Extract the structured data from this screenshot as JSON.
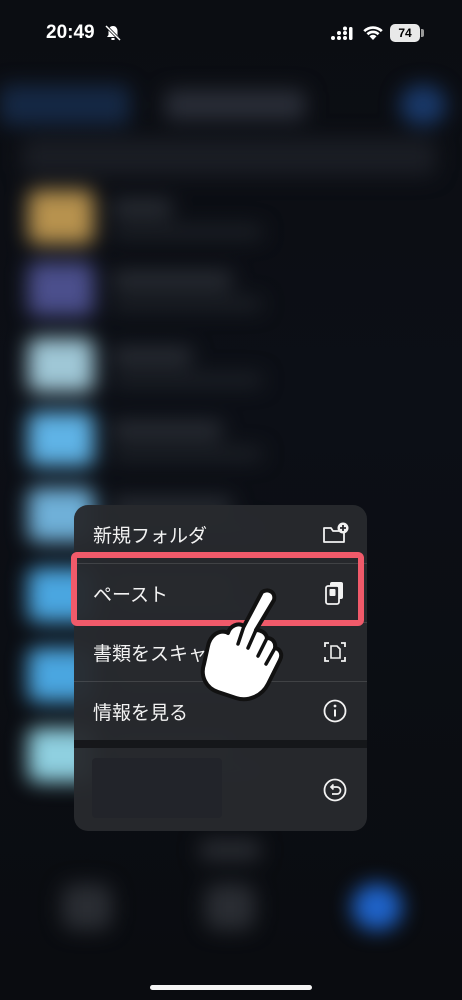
{
  "status_bar": {
    "time": "20:49",
    "battery": "74"
  },
  "context_menu": {
    "items": [
      {
        "label": "新規フォルダ",
        "icon": "folder-add-icon"
      },
      {
        "label": "ペースト",
        "icon": "paste-icon"
      },
      {
        "label": "書類をスキャン",
        "icon": "scan-document-icon"
      },
      {
        "label": "情報を見る",
        "icon": "info-icon"
      }
    ],
    "bottom_icon": "undo-icon"
  },
  "highlight_color": "#f05a6a"
}
